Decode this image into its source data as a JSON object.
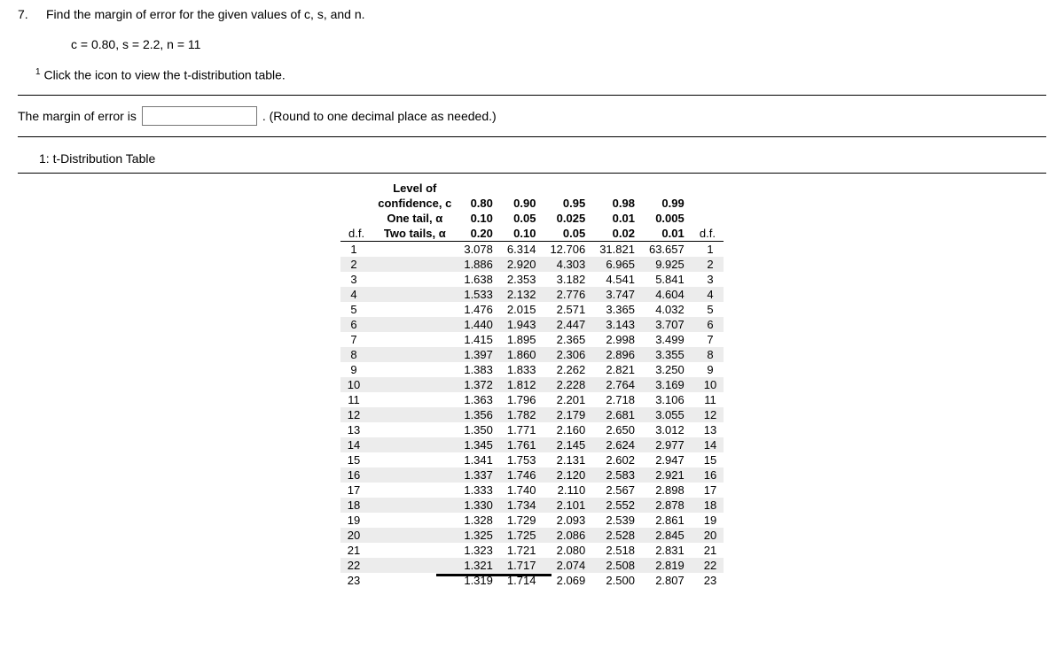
{
  "question": {
    "number": "7.",
    "prompt": "Find the margin of error for the given values of c, s, and n.",
    "given": "c = 0.80, s = 2.2, n = 11",
    "footnote_super": "1",
    "footnote_text": " Click the icon to view the t-distribution table.",
    "answer_label_before": "The margin of error is ",
    "answer_label_after": ". (Round to one decimal place as needed.)",
    "reference_label": "1: t-Distribution Table"
  },
  "table": {
    "level_of_label": "Level of",
    "confidence_label": "confidence, c",
    "one_tail_label": "One tail, α",
    "two_tails_label": "Two tails, α",
    "df_label": "d.f.",
    "confidence_levels": [
      "0.80",
      "0.90",
      "0.95",
      "0.98",
      "0.99"
    ],
    "one_tail": [
      "0.10",
      "0.05",
      "0.025",
      "0.01",
      "0.005"
    ],
    "two_tails": [
      "0.20",
      "0.10",
      "0.05",
      "0.02",
      "0.01"
    ],
    "rows": [
      {
        "df": "1",
        "v": [
          "3.078",
          "6.314",
          "12.706",
          "31.821",
          "63.657"
        ]
      },
      {
        "df": "2",
        "v": [
          "1.886",
          "2.920",
          "4.303",
          "6.965",
          "9.925"
        ]
      },
      {
        "df": "3",
        "v": [
          "1.638",
          "2.353",
          "3.182",
          "4.541",
          "5.841"
        ]
      },
      {
        "df": "4",
        "v": [
          "1.533",
          "2.132",
          "2.776",
          "3.747",
          "4.604"
        ]
      },
      {
        "df": "5",
        "v": [
          "1.476",
          "2.015",
          "2.571",
          "3.365",
          "4.032"
        ]
      },
      {
        "df": "6",
        "v": [
          "1.440",
          "1.943",
          "2.447",
          "3.143",
          "3.707"
        ]
      },
      {
        "df": "7",
        "v": [
          "1.415",
          "1.895",
          "2.365",
          "2.998",
          "3.499"
        ]
      },
      {
        "df": "8",
        "v": [
          "1.397",
          "1.860",
          "2.306",
          "2.896",
          "3.355"
        ]
      },
      {
        "df": "9",
        "v": [
          "1.383",
          "1.833",
          "2.262",
          "2.821",
          "3.250"
        ]
      },
      {
        "df": "10",
        "v": [
          "1.372",
          "1.812",
          "2.228",
          "2.764",
          "3.169"
        ]
      },
      {
        "df": "11",
        "v": [
          "1.363",
          "1.796",
          "2.201",
          "2.718",
          "3.106"
        ]
      },
      {
        "df": "12",
        "v": [
          "1.356",
          "1.782",
          "2.179",
          "2.681",
          "3.055"
        ]
      },
      {
        "df": "13",
        "v": [
          "1.350",
          "1.771",
          "2.160",
          "2.650",
          "3.012"
        ]
      },
      {
        "df": "14",
        "v": [
          "1.345",
          "1.761",
          "2.145",
          "2.624",
          "2.977"
        ]
      },
      {
        "df": "15",
        "v": [
          "1.341",
          "1.753",
          "2.131",
          "2.602",
          "2.947"
        ]
      },
      {
        "df": "16",
        "v": [
          "1.337",
          "1.746",
          "2.120",
          "2.583",
          "2.921"
        ]
      },
      {
        "df": "17",
        "v": [
          "1.333",
          "1.740",
          "2.110",
          "2.567",
          "2.898"
        ]
      },
      {
        "df": "18",
        "v": [
          "1.330",
          "1.734",
          "2.101",
          "2.552",
          "2.878"
        ]
      },
      {
        "df": "19",
        "v": [
          "1.328",
          "1.729",
          "2.093",
          "2.539",
          "2.861"
        ]
      },
      {
        "df": "20",
        "v": [
          "1.325",
          "1.725",
          "2.086",
          "2.528",
          "2.845"
        ]
      },
      {
        "df": "21",
        "v": [
          "1.323",
          "1.721",
          "2.080",
          "2.518",
          "2.831"
        ]
      },
      {
        "df": "22",
        "v": [
          "1.321",
          "1.717",
          "2.074",
          "2.508",
          "2.819"
        ]
      },
      {
        "df": "23",
        "v": [
          "1.319",
          "1.714",
          "2.069",
          "2.500",
          "2.807"
        ]
      }
    ]
  }
}
